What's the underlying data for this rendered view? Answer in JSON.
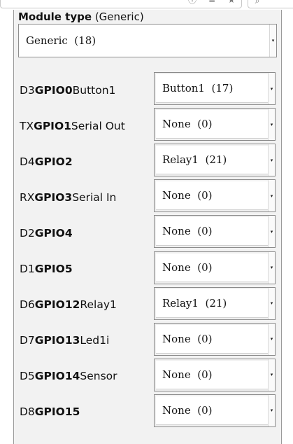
{
  "module": {
    "label_bold": "Module type",
    "label_rest": " (Generic)",
    "selected": "Generic  (18)"
  },
  "gpio_rows": [
    {
      "pin": "D3",
      "gpio": "GPIO0",
      "desc": "Button1",
      "value": "Button1  (17)"
    },
    {
      "pin": "TX",
      "gpio": "GPIO1",
      "desc": "Serial Out",
      "value": "None  (0)"
    },
    {
      "pin": "D4",
      "gpio": "GPIO2",
      "desc": "",
      "value": "Relay1  (21)"
    },
    {
      "pin": "RX",
      "gpio": "GPIO3",
      "desc": "Serial In",
      "value": "None  (0)"
    },
    {
      "pin": "D2",
      "gpio": "GPIO4",
      "desc": "",
      "value": "None  (0)"
    },
    {
      "pin": "D1",
      "gpio": "GPIO5",
      "desc": "",
      "value": "None  (0)"
    },
    {
      "pin": "D6",
      "gpio": "GPIO12",
      "desc": "Relay1",
      "value": "Relay1  (21)"
    },
    {
      "pin": "D7",
      "gpio": "GPIO13",
      "desc": "Led1i",
      "value": "None  (0)"
    },
    {
      "pin": "D5",
      "gpio": "GPIO14",
      "desc": "Sensor",
      "value": "None  (0)"
    },
    {
      "pin": "D8",
      "gpio": "GPIO15",
      "desc": "",
      "value": "None  (0)"
    }
  ],
  "icons": {
    "toolbar": [
      "info-icon",
      "library-icon",
      "bookmark-icon",
      "search-icon"
    ],
    "select_arrow": "dropdown-arrow-icon"
  }
}
